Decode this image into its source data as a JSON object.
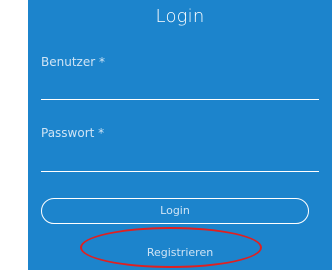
{
  "form": {
    "title": "Login",
    "user_label": "Benutzer *",
    "user_value": "",
    "password_label": "Passwort *",
    "password_value": "",
    "login_button_label": "Login",
    "register_link_label": "Registrieren"
  },
  "colors": {
    "panel_background": "#1c84cc",
    "text": "#ffffff",
    "muted_text": "#cfe4f5",
    "highlight": "#e02020"
  }
}
